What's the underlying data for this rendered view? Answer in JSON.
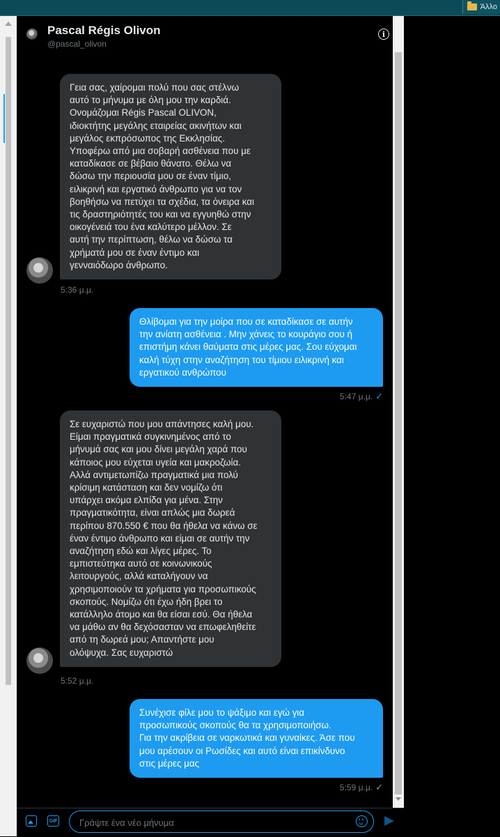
{
  "browser": {
    "bookmark_label": "Άλλο"
  },
  "header": {
    "name": "Pascal Régis Olivon",
    "handle": "@pascal_olivon"
  },
  "messages": [
    {
      "direction": "in",
      "text": "Γεια σας, χαίρομαι πολύ που σας στέλνω\nαυτό το μήνυμα με όλη μου την καρδιά.\nΟνομάζομαι Régis Pascal OLIVON,\nιδιοκτήτης μεγάλης εταιρείας ακινήτων και\nμεγάλος εκπρόσωπος της Εκκλησίας.\nΥποφέρω από μια σοβαρή ασθένεια που με\nκαταδίκασε σε βέβαιο θάνατο.  Θέλω να\nδώσω την περιουσία μου σε έναν τίμιο,\nειλικρινή και εργατικό άνθρωπο για να τον\nβοηθήσω να πετύχει τα σχέδια, τα όνειρα και\nτις δραστηριότητές του και να εγγυηθώ στην\nοικογένειά του ένα καλύτερο μέλλον.  Σε\nαυτή την περίπτωση, θέλω να δώσω τα\nχρήματά μου σε έναν έντιμο και\nγενναιόδωρο άνθρωπο.",
      "time": "5:36 μ.μ."
    },
    {
      "direction": "out",
      "text": "Θλίβομαι  για την μοίρα που σε καταδίκασε σε αυτήν\nτην ανίατη ασθένεια . Μην χάνεις το κουράγιο σου ή\nεπιστήμη κάνει θαύματα στις μέρες μας. Σου εύχομαι\nκαλή τύχη στην αναζήτηση του τίμιου ειλικρινή και\nεργατικού ανθρώπου",
      "time": "5:47 μ.μ.",
      "check": "✓"
    },
    {
      "direction": "in",
      "text": "Σε ευχαριστώ που μου απάντησες καλή μου.\nΕίμαι πραγματικά συγκινημένος από το\nμήνυμά σας και μου δίνει μεγάλη χαρά που\nκάποιος μου εύχεται υγεία και μακροζωία.\nΑλλά αντιμετωπίζω πραγματικά μια πολύ\nκρίσιμη κατάσταση και δεν νομίζω ότι\nυπάρχει ακόμα ελπίδα για μένα.  Στην\nπραγματικότητα, είναι απλώς μια δωρεά\nπερίπου 870.550 € που θα ήθελα να κάνω σε\nέναν έντιμο άνθρωπο και είμαι σε αυτήν την\nαναζήτηση εδώ και λίγες μέρες.  Το\nεμπιστεύτηκα αυτό σε κοινωνικούς\nλειτουργούς, αλλά καταλήγουν να\nχρησιμοποιούν τα χρήματα για προσωπικούς\nσκοπούς.  Νομίζω ότι έχω ήδη βρει το\nκατάλληλο άτομο και θα είσαι εσύ.  Θα ήθελα\nνα μάθω αν θα δεχόσασταν να επωφεληθείτε\nαπό τη δωρεά μου;  Απαντήστε μου\nολόψυχα.  Σας ευχαριστώ",
      "time": "5:52 μ.μ."
    },
    {
      "direction": "out",
      "text": "Συνέχισε φίλε μου το ψάξιμο και εγώ για\nπροσωπικούς σκοπούς θα τα χρησιμοποιήσω.\nΓια την ακρίβεια σε ναρκωτικά και γυναίκες.  Άσε που\nμου αρέσουν οι Ρωσίδες και αυτό είναι επικίνδυνο\nστις μέρες μας",
      "time": "5:59 μ.μ.",
      "check": "✓"
    }
  ],
  "composer": {
    "placeholder": "Γράψτε ένα νέο μήνυμα",
    "gif_label": "GIF"
  }
}
